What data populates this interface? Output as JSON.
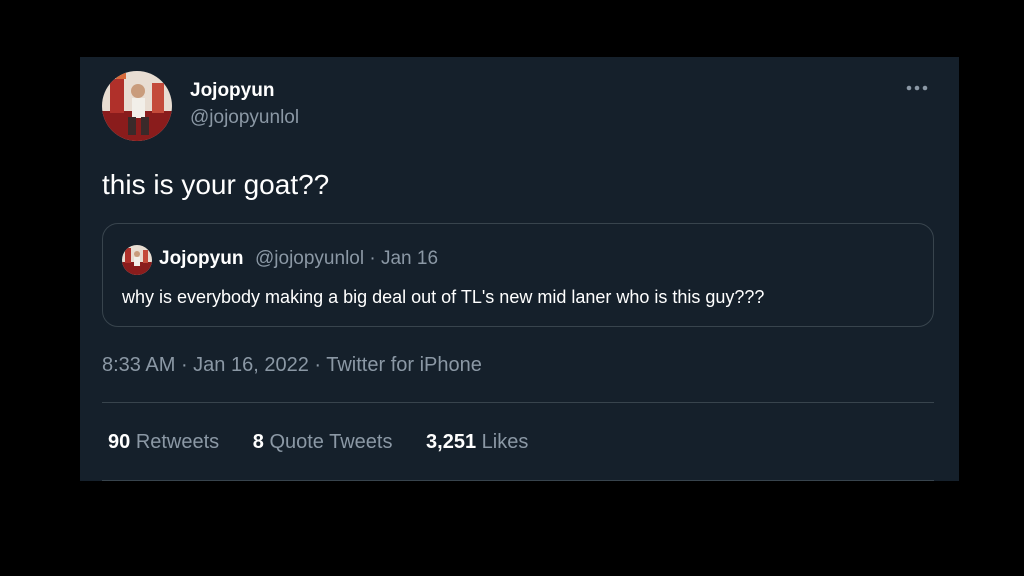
{
  "tweet": {
    "author": {
      "display_name": "Jojopyun",
      "handle": "@jojopyunlol"
    },
    "text": "this is your goat??",
    "more_icon": "more-horizontal-icon",
    "quoted": {
      "display_name": "Jojopyun",
      "meta": "@jojopyunlol · Jan 16",
      "text": "why is everybody making a big deal out of TL's new mid laner who is this guy???"
    },
    "time": "8:33 AM",
    "date": "Jan 16, 2022",
    "source": "Twitter for iPhone",
    "separator": " · ",
    "stats": {
      "retweets_count": "90",
      "retweets_label": "Retweets",
      "quote_tweets_count": "8",
      "quote_tweets_label": "Quote Tweets",
      "likes_count": "3,251",
      "likes_label": "Likes"
    }
  },
  "colors": {
    "background": "#000000",
    "card": "#15202b",
    "primary_text": "#ffffff",
    "secondary_text": "#8b98a5",
    "border": "#38444d"
  }
}
